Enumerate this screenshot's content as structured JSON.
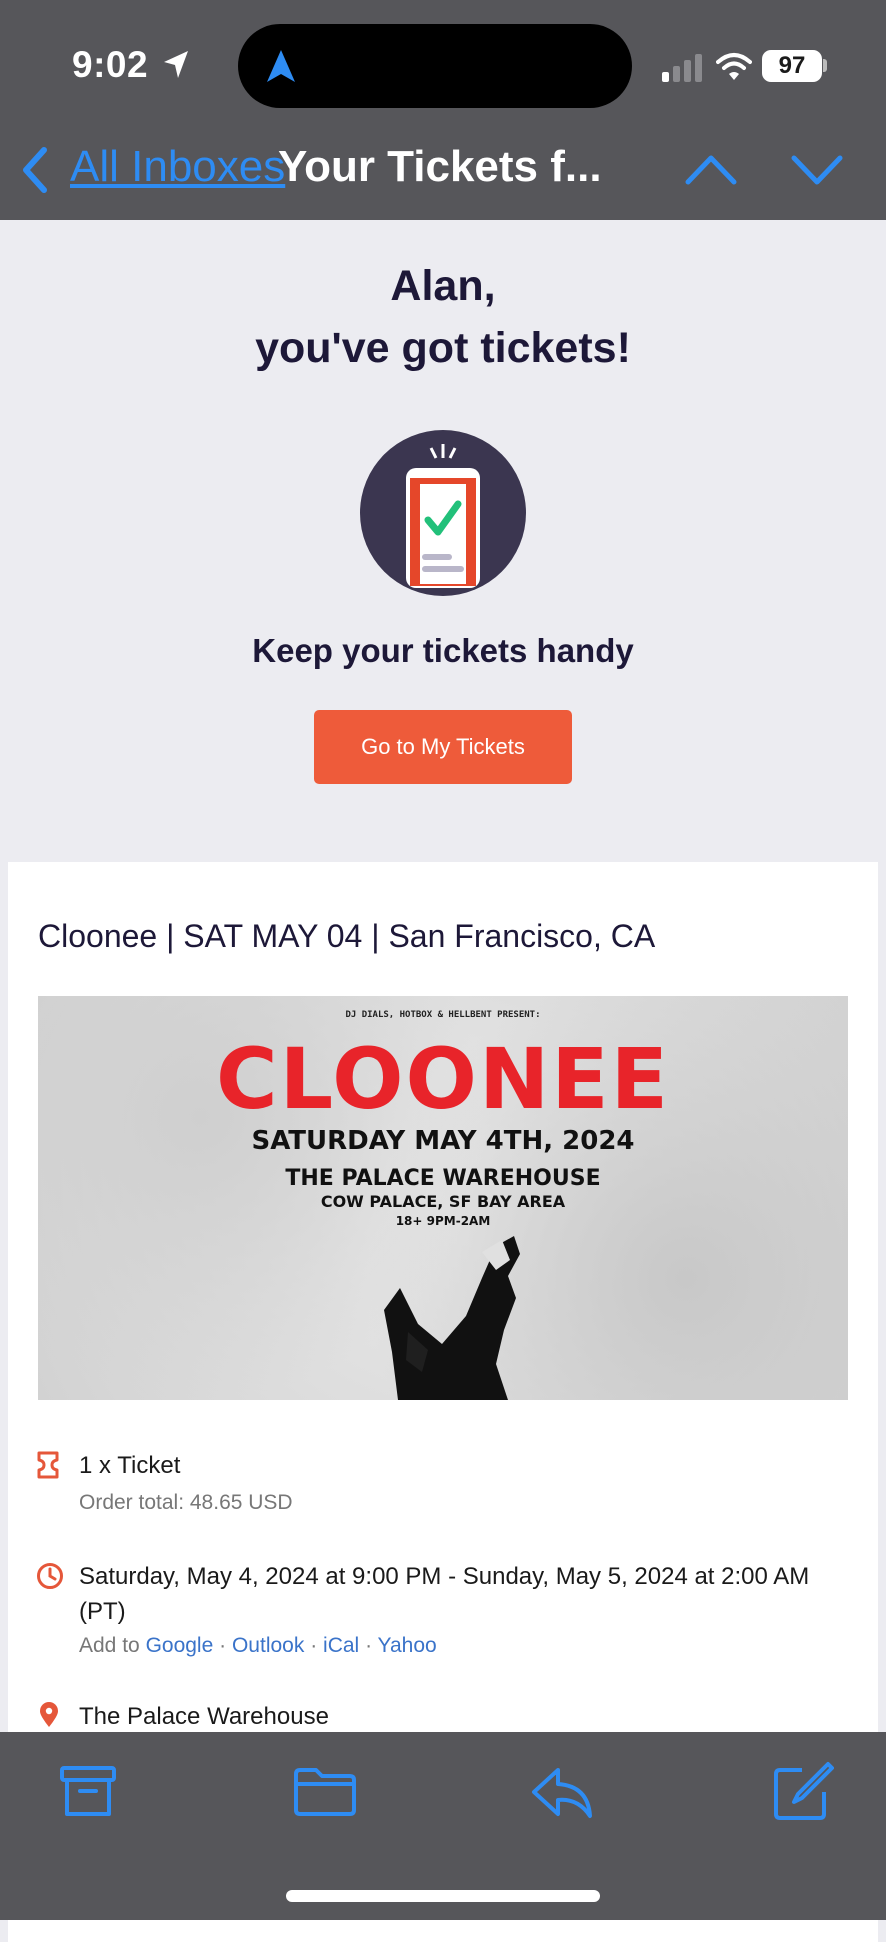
{
  "status_bar": {
    "time": "9:02",
    "battery": "97"
  },
  "nav": {
    "back_label": "All Inboxes",
    "title": "Your Tickets f..."
  },
  "hero": {
    "greeting_line1": "Alan,",
    "greeting_line2": "you've got tickets!",
    "subtitle": "Keep your tickets handy",
    "button_label": "Go to My Tickets"
  },
  "event": {
    "title": "Cloonee | SAT MAY 04 | San Francisco, CA",
    "poster": {
      "presenters": "DJ DIALS, HOTBOX & HELLBENT PRESENT:",
      "artist": "CLOONEE",
      "date": "SATURDAY MAY 4TH, 2024",
      "venue": "THE PALACE WAREHOUSE",
      "location": "COW PALACE, SF BAY AREA",
      "time": "18+ 9PM-2AM"
    },
    "ticket": {
      "label": "1 x Ticket",
      "order_total": "Order total: 48.65 USD"
    },
    "datetime": {
      "line1": "Saturday, May 4, 2024 at 9:00 PM - Sunday, May 5, 2024 at 2:00 AM",
      "line2": "(PT)",
      "add_to": "Add to",
      "calendars": [
        "Google",
        "Outlook",
        "iCal",
        "Yahoo"
      ]
    },
    "venue_name": "The Palace Warehouse"
  },
  "colors": {
    "accent": "#ee5b3a",
    "link": "#3a73c9",
    "ios_blue": "#2e8cf3",
    "bar_bg": "#56565a"
  }
}
